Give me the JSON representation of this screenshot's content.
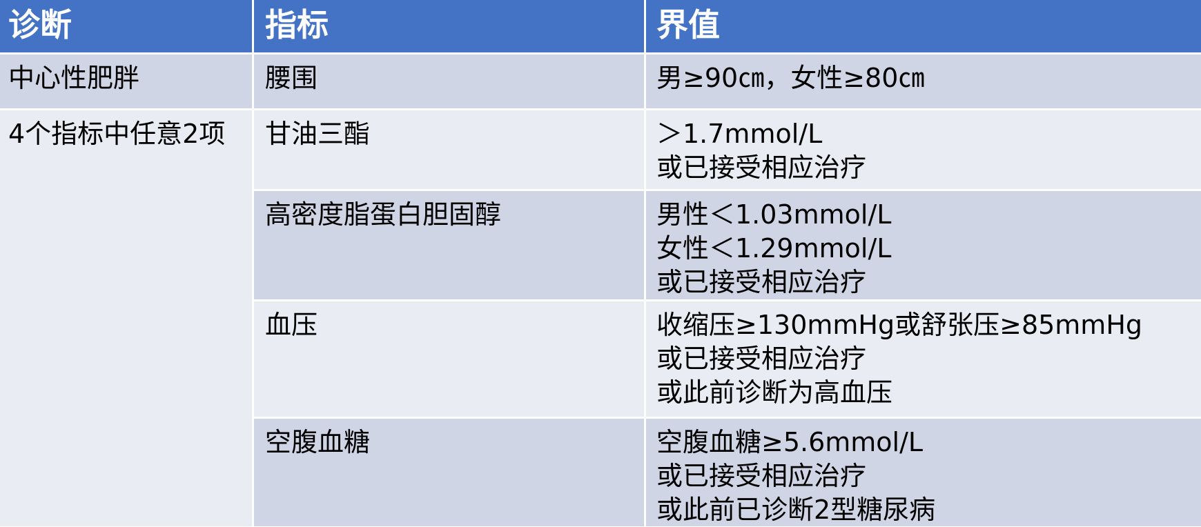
{
  "table": {
    "header": [
      "诊断",
      "指标",
      "界值"
    ],
    "diagnosis_obesity": "中心性肥胖",
    "diagnosis_any2": "4个指标中任意2项",
    "rows": [
      {
        "indicator": "腰围",
        "threshold": [
          "男≥90㎝，女性≥80㎝"
        ]
      },
      {
        "indicator": "甘油三酯",
        "threshold": [
          "＞1.7mmol/L",
          "或已接受相应治疗"
        ]
      },
      {
        "indicator": "高密度脂蛋白胆固醇",
        "threshold": [
          "男性＜1.03mmol/L",
          "女性＜1.29mmol/L",
          "或已接受相应治疗"
        ]
      },
      {
        "indicator": "血压",
        "threshold": [
          "收缩压≥130mmHg或舒张压≥85mmHg",
          "或已接受相应治疗",
          "或此前诊断为高血压"
        ]
      },
      {
        "indicator": "空腹血糖",
        "threshold": [
          "空腹血糖≥5.6mmol/L",
          "或已接受相应治疗",
          "或此前已诊断2型糖尿病"
        ]
      }
    ]
  }
}
